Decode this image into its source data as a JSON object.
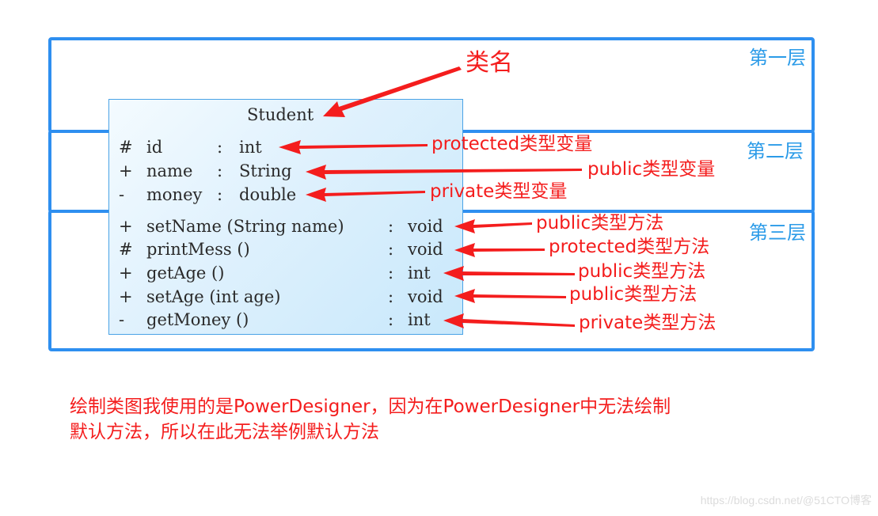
{
  "layers": [
    {
      "label": "第一层"
    },
    {
      "label": "第二层"
    },
    {
      "label": "第三层"
    }
  ],
  "uml_class": {
    "name": "Student",
    "attributes": [
      {
        "visibility": "#",
        "name": "id",
        "type": "int",
        "annotation": "protected类型变量"
      },
      {
        "visibility": "+",
        "name": "name",
        "type": "String",
        "annotation": "public类型变量"
      },
      {
        "visibility": "-",
        "name": "money",
        "type": "double",
        "annotation": "private类型变量"
      }
    ],
    "methods": [
      {
        "visibility": "+",
        "signature": "setName (String name)",
        "type": "void",
        "annotation": "public类型方法"
      },
      {
        "visibility": "#",
        "signature": "printMess ()",
        "type": "void",
        "annotation": "protected类型方法"
      },
      {
        "visibility": "+",
        "signature": "getAge ()",
        "type": "int",
        "annotation": "public类型方法"
      },
      {
        "visibility": "+",
        "signature": "setAge (int age)",
        "type": "void",
        "annotation": "public类型方法"
      },
      {
        "visibility": "-",
        "signature": "getMoney ()",
        "type": "int",
        "annotation": "private类型方法"
      }
    ]
  },
  "class_name_annotation": "类名",
  "note": {
    "line1": "绘制类图我使用的是PowerDesigner，因为在PowerDesigner中无法绘制",
    "line2": "默认方法，所以在此无法举例默认方法"
  },
  "watermark": "https://blog.csdn.net/@51CTO博客",
  "colors": {
    "layer_border": "#2e8ff0",
    "layer_label": "#2b9be8",
    "annotation": "#f41d1d",
    "class_border": "#4aa3e6"
  }
}
